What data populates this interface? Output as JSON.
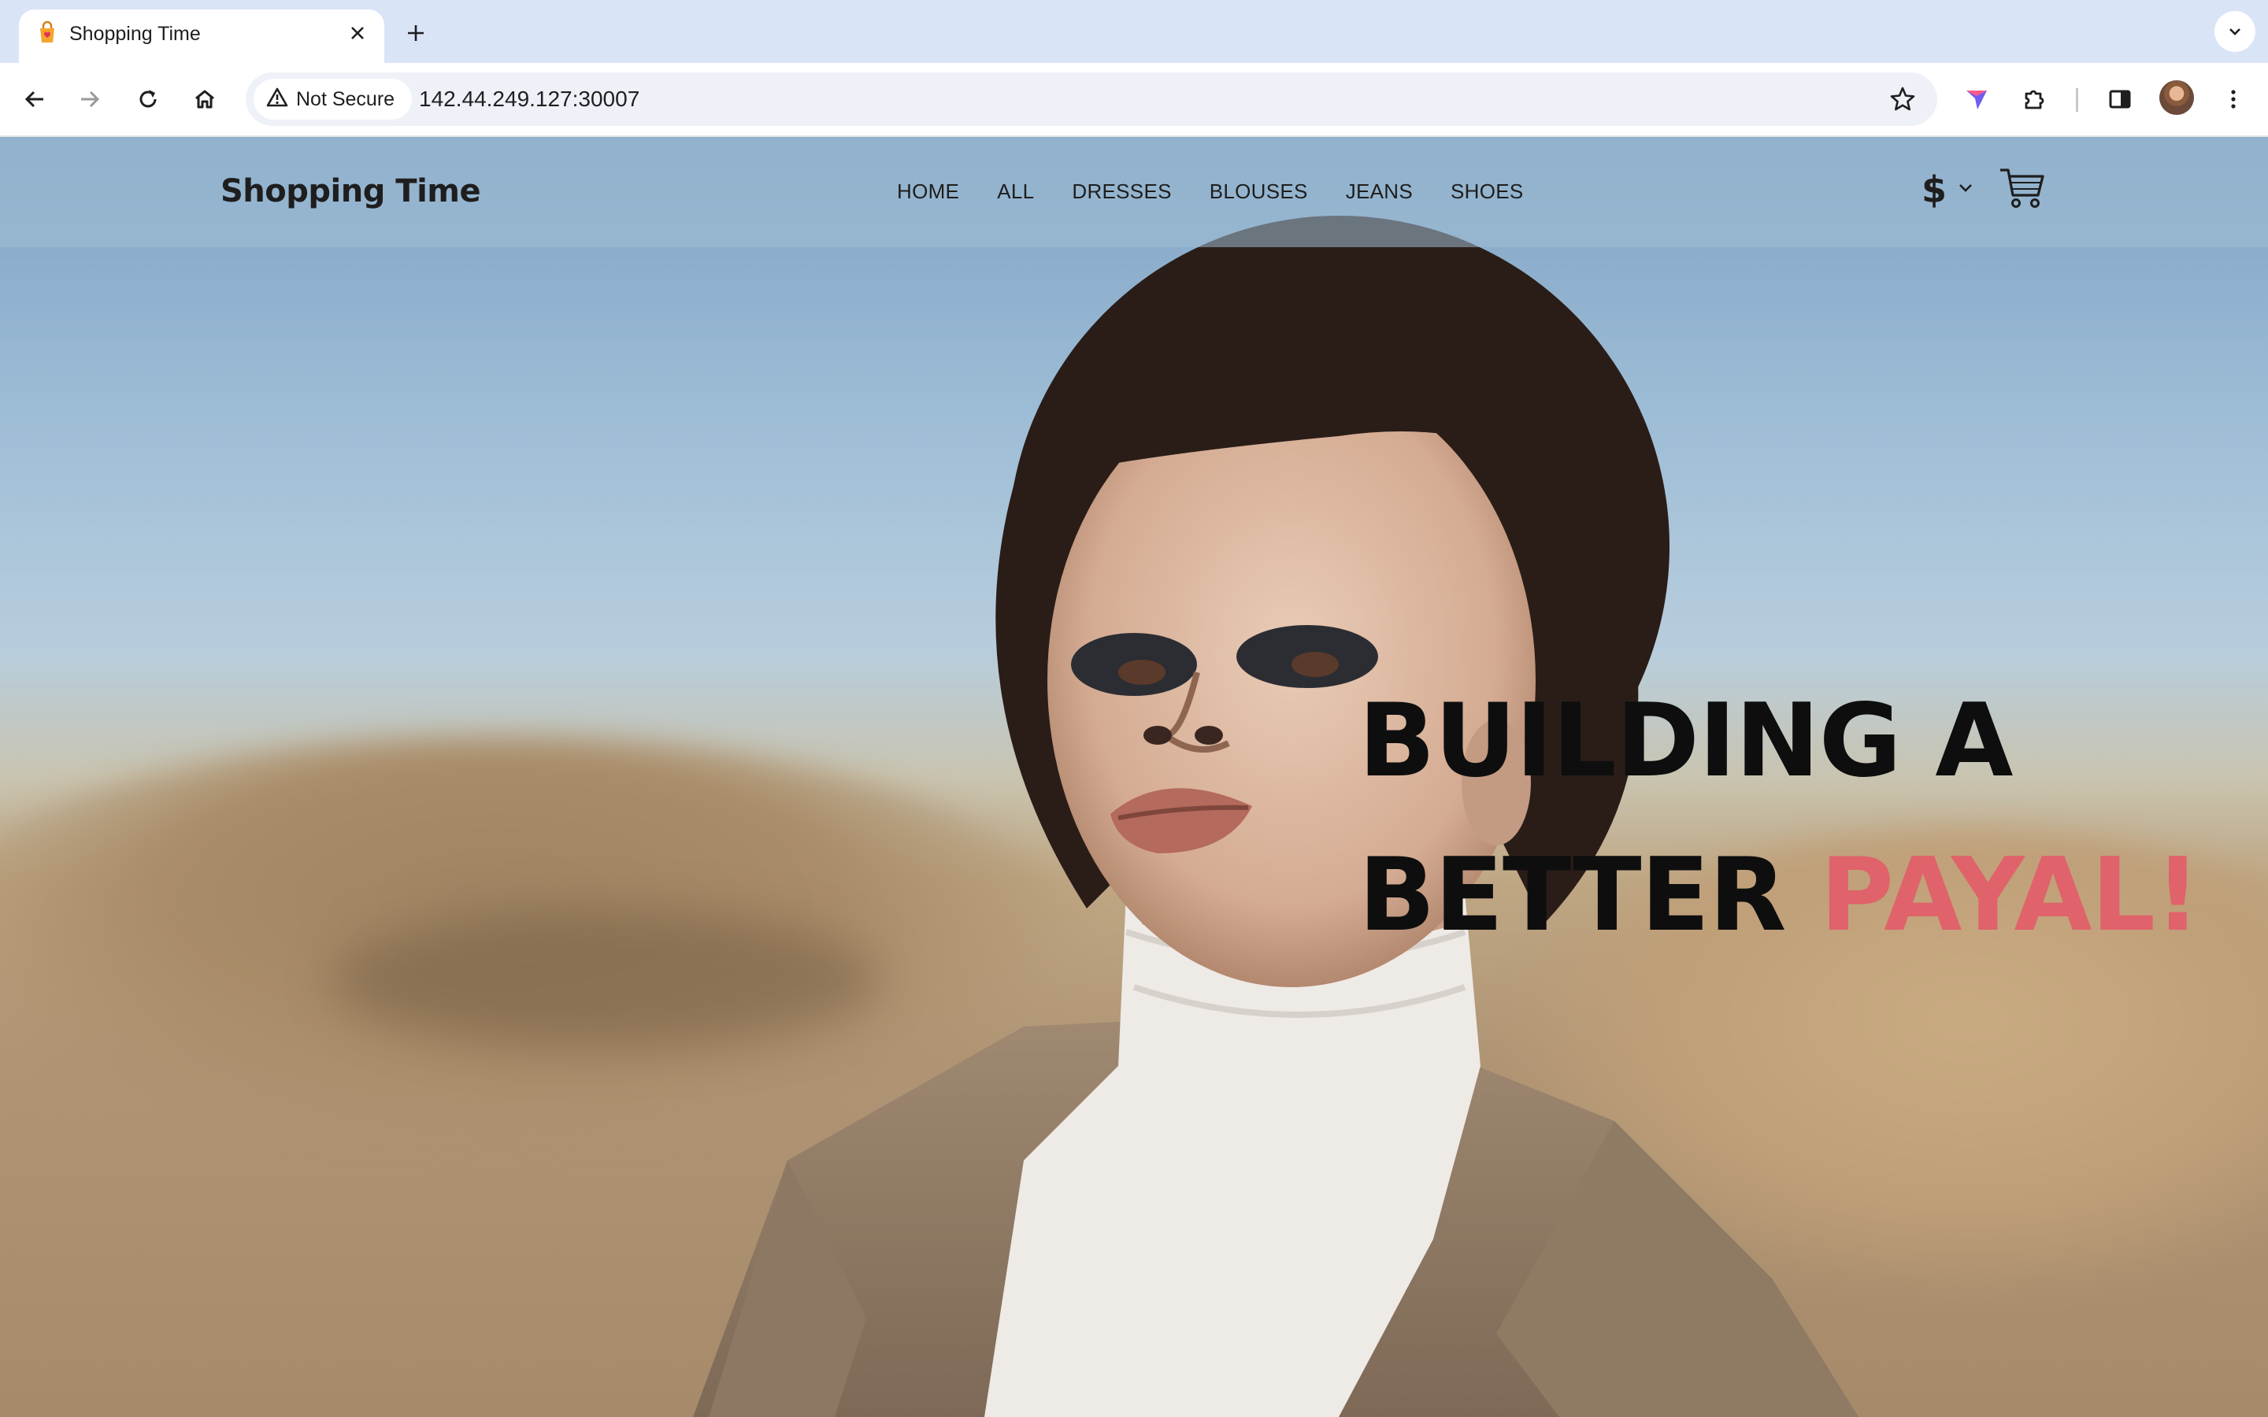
{
  "browser": {
    "tab_title": "Shopping Time",
    "security_label": "Not Secure",
    "url": "142.44.249.127:30007",
    "icons": [
      "back-icon",
      "forward-icon",
      "reload-icon",
      "home-icon",
      "warning-icon",
      "star-icon",
      "extension-icon",
      "puzzle-icon",
      "side-panel-icon",
      "profile-avatar",
      "menu-icon"
    ]
  },
  "site": {
    "brand": "Shopping Time",
    "nav": [
      "HOME",
      "ALL",
      "DRESSES",
      "BLOUSES",
      "JEANS",
      "SHOES"
    ],
    "currency_symbol": "$",
    "cart_icon": "cart-icon"
  },
  "hero": {
    "line1": "BUILDING A",
    "line2_prefix": "BETTER",
    "line2_accent": "PAYAL!",
    "accent_color": "#e0626a"
  }
}
